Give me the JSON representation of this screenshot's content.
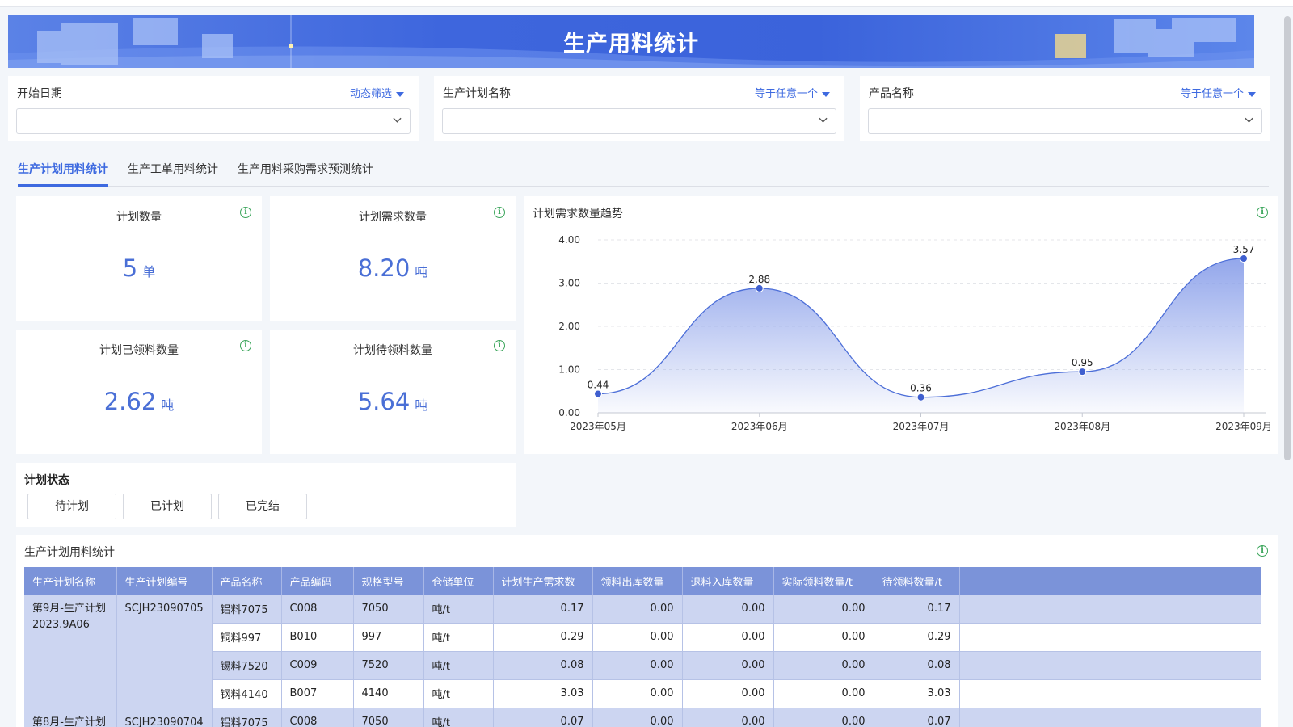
{
  "page": {
    "title": "生产用料统计"
  },
  "filters": [
    {
      "label": "开始日期",
      "mode": "动态筛选",
      "value": ""
    },
    {
      "label": "生产计划名称",
      "mode": "等于任意一个",
      "value": ""
    },
    {
      "label": "产品名称",
      "mode": "等于任意一个",
      "value": ""
    }
  ],
  "tabs": [
    {
      "label": "生产计划用料统计",
      "active": true
    },
    {
      "label": "生产工单用料统计",
      "active": false
    },
    {
      "label": "生产用料采购需求预测统计",
      "active": false
    }
  ],
  "kpis": [
    {
      "title": "计划数量",
      "value": "5",
      "unit": "单"
    },
    {
      "title": "计划需求数量",
      "value": "8.20",
      "unit": "吨"
    },
    {
      "title": "计划已领料数量",
      "value": "2.62",
      "unit": "吨"
    },
    {
      "title": "计划待领料数量",
      "value": "5.64",
      "unit": "吨"
    }
  ],
  "info_icon": "info-icon",
  "chart": {
    "title": "计划需求数量趋势"
  },
  "chart_data": {
    "type": "area",
    "categories": [
      "2023年05月",
      "2023年06月",
      "2023年07月",
      "2023年08月",
      "2023年09月"
    ],
    "series": [
      {
        "values": [
          0.44,
          2.88,
          0.36,
          0.95,
          3.57
        ]
      }
    ],
    "value_labels": [
      "0.44",
      "2.88",
      "0.36",
      "0.95",
      "3.57"
    ],
    "yticks": [
      "0.00",
      "1.00",
      "2.00",
      "3.00",
      "4.00"
    ],
    "ylim": [
      0,
      4
    ],
    "smooth": true,
    "grid": true,
    "colors": {
      "line": "#4d6fd8",
      "fill": "#8da2ea"
    }
  },
  "status": {
    "title": "计划状态",
    "buttons": [
      "待计划",
      "已计划",
      "已完结"
    ]
  },
  "table": {
    "title": "生产计划用料统计",
    "columns": [
      "生产计划名称",
      "生产计划编号",
      "产品名称",
      "产品编码",
      "规格型号",
      "仓储单位",
      "计划生产需求数",
      "领料出库数量",
      "退料入库数量",
      "实际领料数量/t",
      "待领料数量/t",
      ""
    ],
    "groups": [
      {
        "plan_name": "第9月-生产计划2023.9A06",
        "plan_no": "SCJH23090705",
        "rows": [
          [
            "铝料7075",
            "C008",
            "7050",
            "吨/t",
            "0.17",
            "0.00",
            "0.00",
            "0.00",
            "0.17"
          ],
          [
            "铜料997",
            "B010",
            "997",
            "吨/t",
            "0.29",
            "0.00",
            "0.00",
            "0.00",
            "0.29"
          ],
          [
            "锡料7520",
            "C009",
            "7520",
            "吨/t",
            "0.08",
            "0.00",
            "0.00",
            "0.00",
            "0.08"
          ],
          [
            "钢料4140",
            "B007",
            "4140",
            "吨/t",
            "3.03",
            "0.00",
            "0.00",
            "0.00",
            "3.03"
          ]
        ]
      },
      {
        "plan_name": "第8月-生产计划",
        "plan_no": "SCJH23090704",
        "rows": [
          [
            "铝料7075",
            "C008",
            "7050",
            "吨/t",
            "0.07",
            "0.00",
            "0.00",
            "0.00",
            "0.07"
          ]
        ]
      }
    ]
  }
}
